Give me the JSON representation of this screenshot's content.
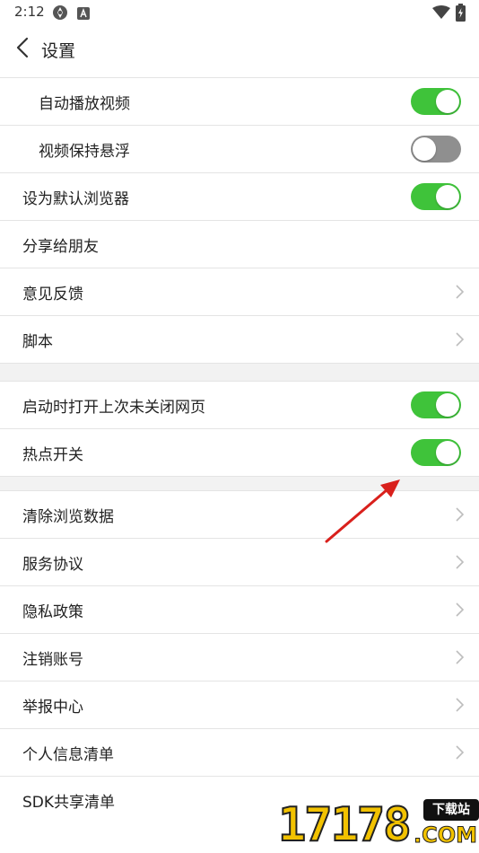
{
  "status_bar": {
    "time": "2:12",
    "icons": [
      "app-icon",
      "a-badge-icon",
      "wifi-icon",
      "battery-charging-icon"
    ]
  },
  "app_bar": {
    "title": "设置",
    "back_icon": "chevron-left-icon"
  },
  "colors": {
    "toggle_on": "#3fc33a",
    "toggle_off": "#8f8f8f",
    "section_gap": "#f2f2f2",
    "arrow": "#d9201c"
  },
  "sections": [
    {
      "items": [
        {
          "label": "自动播放视频",
          "control": "toggle",
          "on": true,
          "indented": true
        },
        {
          "label": "视频保持悬浮",
          "control": "toggle",
          "on": false,
          "indented": true
        },
        {
          "label": "设为默认浏览器",
          "control": "toggle",
          "on": true
        },
        {
          "label": "分享给朋友",
          "control": "none"
        },
        {
          "label": "意见反馈",
          "control": "chevron"
        },
        {
          "label": "脚本",
          "control": "chevron"
        }
      ]
    },
    {
      "items": [
        {
          "label": "启动时打开上次未关闭网页",
          "control": "toggle",
          "on": true
        },
        {
          "label": "热点开关",
          "control": "toggle",
          "on": true
        }
      ]
    },
    {
      "items": [
        {
          "label": "清除浏览数据",
          "control": "chevron"
        },
        {
          "label": "服务协议",
          "control": "chevron"
        },
        {
          "label": "隐私政策",
          "control": "chevron"
        },
        {
          "label": "注销账号",
          "control": "chevron"
        },
        {
          "label": "举报中心",
          "control": "chevron"
        },
        {
          "label": "个人信息清单",
          "control": "chevron"
        },
        {
          "label": "SDK共享清单",
          "control": "chevron"
        }
      ]
    }
  ],
  "watermark": {
    "number": "17178",
    "badge": "下载站",
    "suffix": ".COM"
  }
}
